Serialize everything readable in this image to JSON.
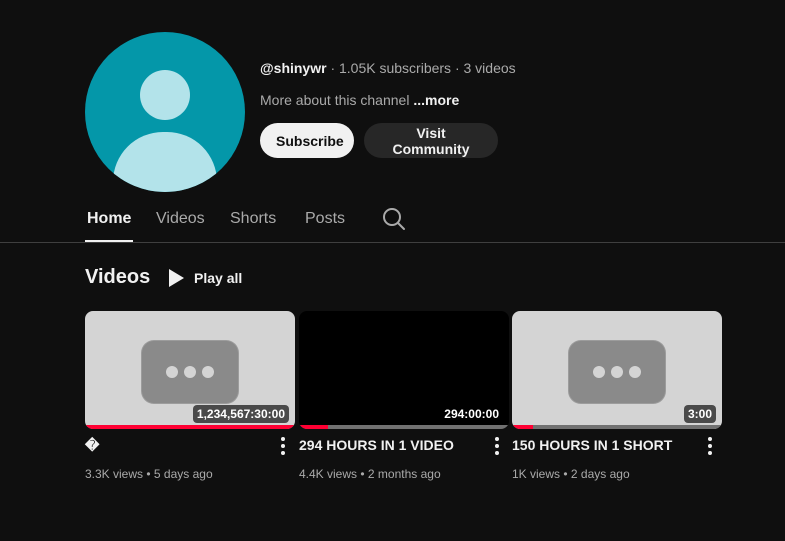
{
  "channel": {
    "handle": "@shinywr",
    "stats": " · 1.05K subscribers · 3 videos",
    "about": "More about this channel",
    "more": " ...more",
    "avatar_icon": "default-avatar-icon"
  },
  "buttons": {
    "subscribe": "Subscribe",
    "community": "Visit Community"
  },
  "tabs": [
    "Home",
    "Videos",
    "Shorts",
    "Posts"
  ],
  "section": {
    "title": "Videos",
    "play_all": "Play all"
  },
  "videos": [
    {
      "title": "�",
      "duration": "1,234,567:30:00",
      "views": "3.3K views",
      "age": "5 days ago",
      "progress": 1.0,
      "thumb": "placeholder"
    },
    {
      "title": "294 HOURS IN 1 VIDEO",
      "duration": "294:00:00",
      "views": "4.4K views",
      "age": "2 months ago",
      "progress": 0.14,
      "thumb": "black"
    },
    {
      "title": "150 HOURS IN 1 SHORT",
      "duration": "3:00",
      "views": "1K views",
      "age": "2 days ago",
      "progress": 0.1,
      "thumb": "placeholder"
    }
  ],
  "colors": {
    "background": "#0f0f0f",
    "avatar": "#0497a9",
    "progress": "#ff0033"
  }
}
